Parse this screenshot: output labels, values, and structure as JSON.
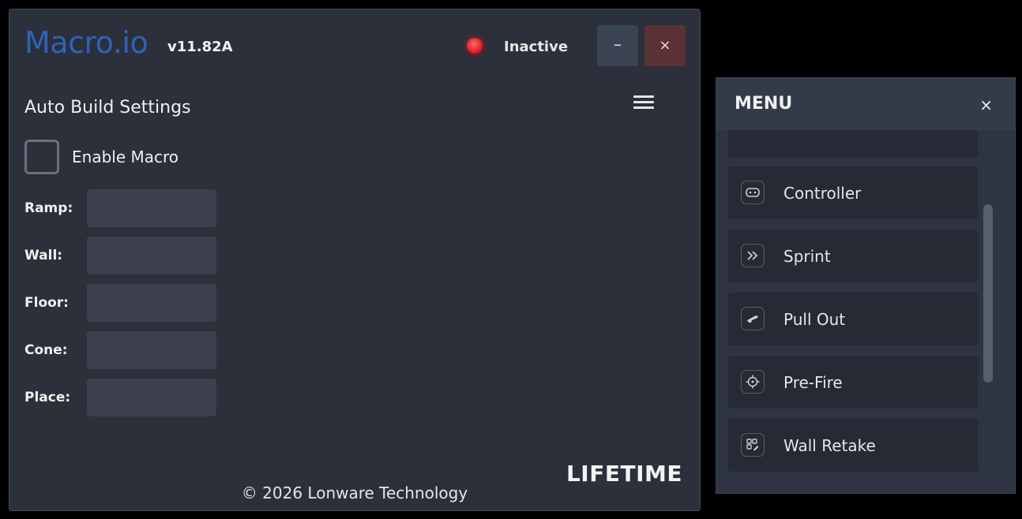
{
  "app": {
    "title": "Macro.io",
    "version": "v11.82A",
    "status": "Inactive",
    "minimize_label": "–",
    "close_label": "×"
  },
  "settings": {
    "section_title": "Auto Build Settings",
    "enable_label": "Enable Macro",
    "fields": [
      {
        "label": "Ramp:",
        "value": ""
      },
      {
        "label": "Wall:",
        "value": ""
      },
      {
        "label": "Floor:",
        "value": ""
      },
      {
        "label": "Cone:",
        "value": ""
      },
      {
        "label": "Place:",
        "value": ""
      }
    ]
  },
  "license": "LIFETIME",
  "footer": "© 2026 Lonware Technology",
  "menu": {
    "title": "MENU",
    "close_label": "×",
    "items": [
      {
        "label": "Controller",
        "icon": "gamepad-icon"
      },
      {
        "label": "Sprint",
        "icon": "double-chevron-icon"
      },
      {
        "label": "Pull Out",
        "icon": "gun-icon"
      },
      {
        "label": "Pre-Fire",
        "icon": "crosshair-icon"
      },
      {
        "label": "Wall Retake",
        "icon": "grid-edit-icon"
      }
    ]
  },
  "colors": {
    "accent": "#2d63b8",
    "status_inactive": "#e3242b",
    "window_bg": "#2b303a",
    "close_bg": "#5a3236"
  }
}
